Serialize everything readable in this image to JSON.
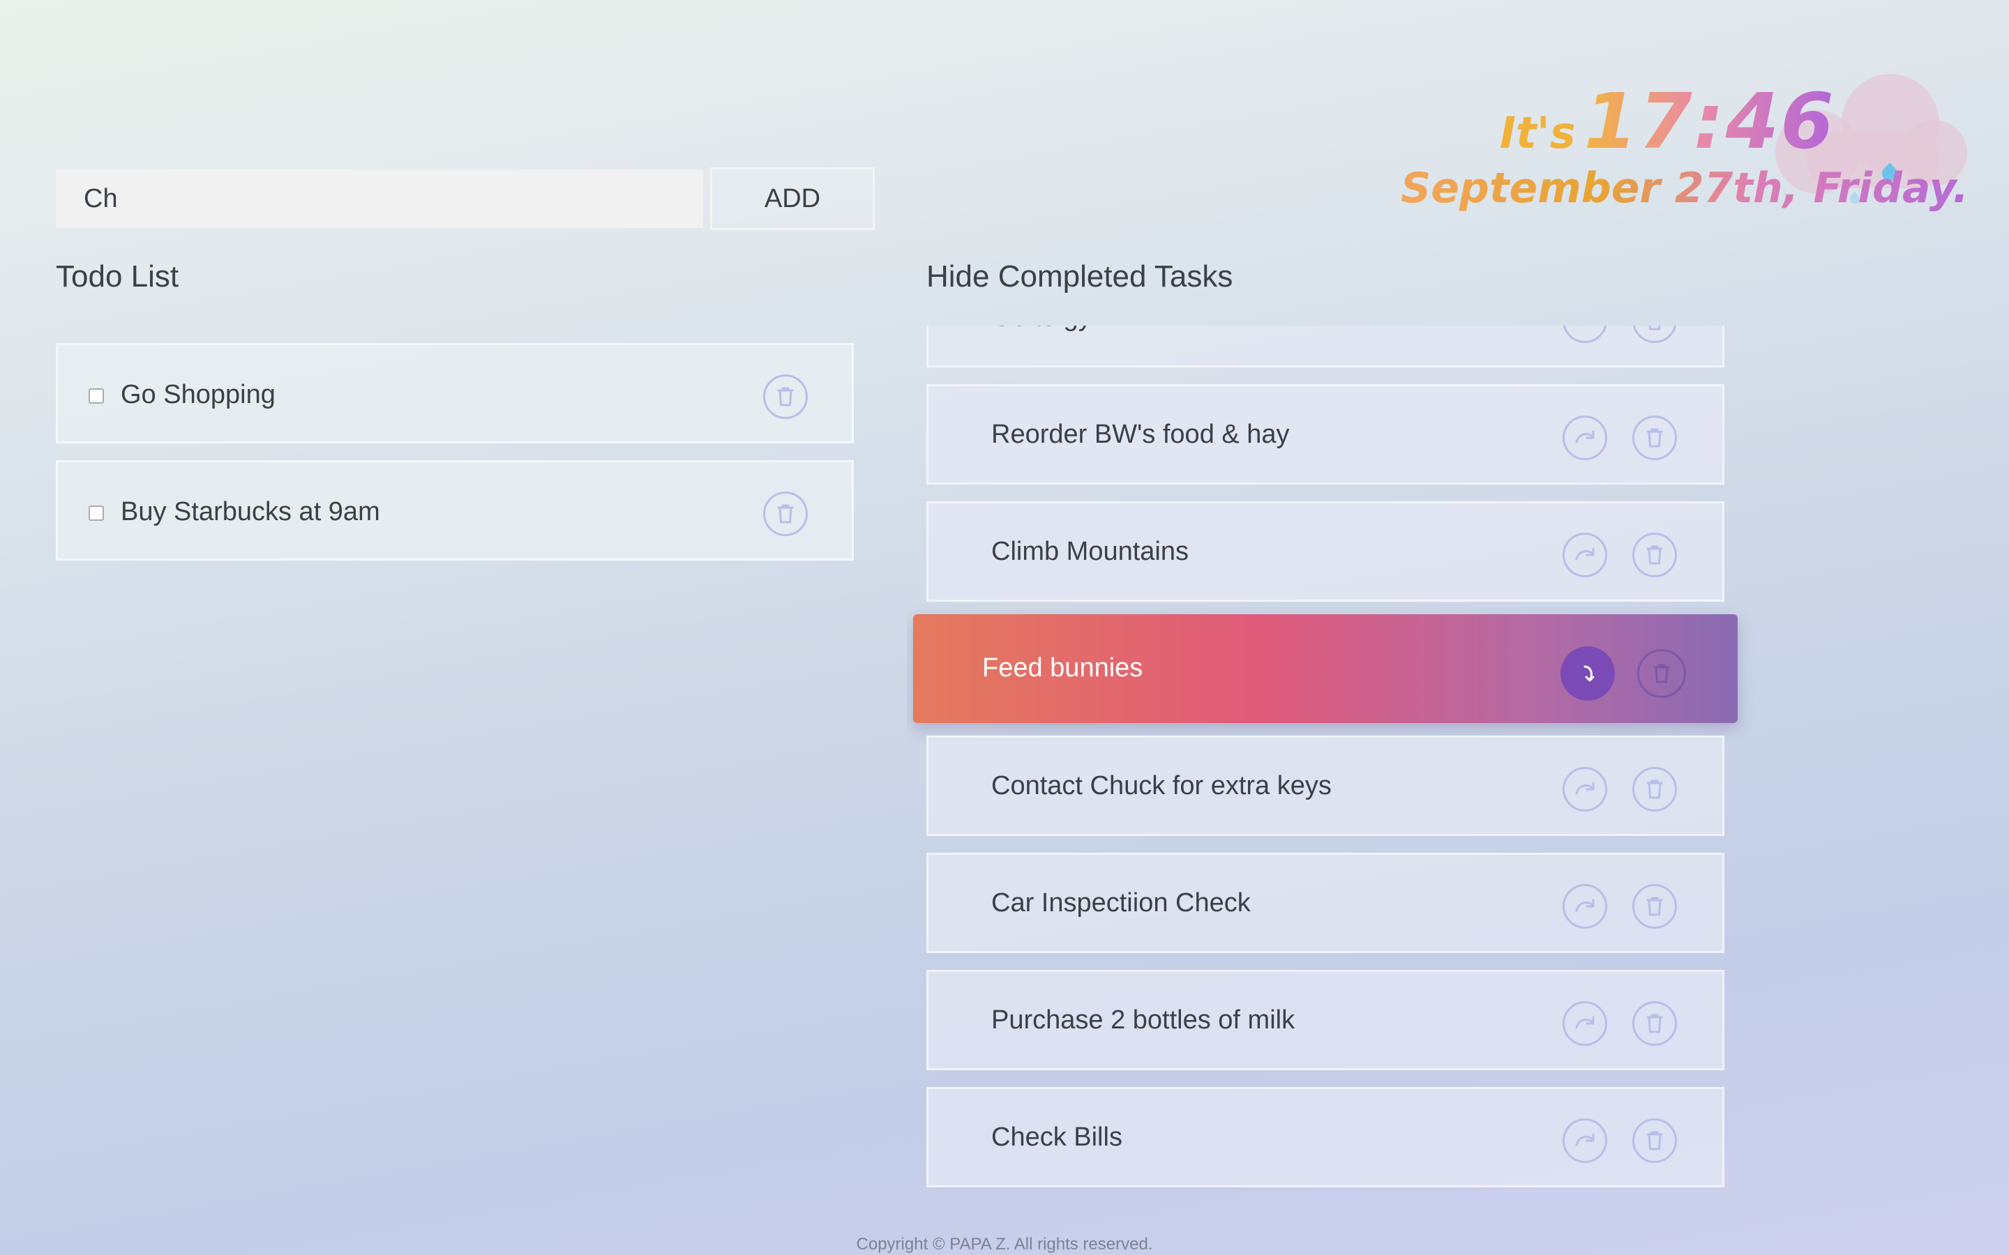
{
  "clock": {
    "prefix": "It's",
    "time": "17:46",
    "date": "September 27th, Friday.",
    "weather_icon": "rain-cloud-icon"
  },
  "add_form": {
    "input_value": "Ch",
    "add_label": "ADD"
  },
  "todo_list": {
    "title": "Todo List",
    "items": [
      {
        "label": "Go Shopping",
        "checked": false
      },
      {
        "label": "Buy Starbucks at 9am",
        "checked": false
      }
    ]
  },
  "completed": {
    "toggle_label": "Hide Completed Tasks",
    "items": [
      {
        "label": "Go to gym"
      },
      {
        "label": "Reorder BW's food & hay"
      },
      {
        "label": "Climb Mountains"
      },
      {
        "label": "Feed bunnies",
        "hovered": true
      },
      {
        "label": "Contact Chuck for extra keys"
      },
      {
        "label": "Car Inspectiion Check"
      },
      {
        "label": "Purchase 2 bottles of milk"
      },
      {
        "label": "Check Bills"
      }
    ]
  },
  "icons": {
    "restore": "redo-arrow-icon",
    "delete": "trash-icon"
  },
  "colors": {
    "accent_gradient_start": "#e57a5c",
    "accent_gradient_mid": "#e05a7a",
    "accent_gradient_end": "#8a6bb3",
    "icon_outline": "#b8bee8",
    "restore_active": "#7b4bb7"
  },
  "footer": {
    "copyright": "Copyright © PAPA Z. All rights reserved."
  }
}
